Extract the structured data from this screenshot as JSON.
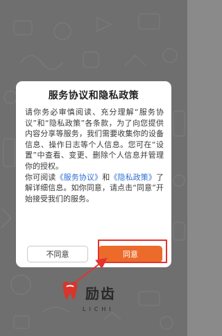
{
  "dialog": {
    "title": "服务协议和隐私政策",
    "paragraph1": "请你务必审慎阅读、充分理解“服务协议”和“隐私政策”各条款，为了向您提供内容分享等服务，我们需要收集你的设备信息、操作日志等个人信息。您可在“设置”中查看、变更、删除个人信息并管理你的授权。",
    "p2_prefix": "你可阅读",
    "service_link": "《服务协议》",
    "p2_and": "和",
    "privacy_link": "《隐私政策》",
    "p2_suffix": "了解详细信息。如你同意，请点击“同意”开始接受我们的服务。",
    "disagree_label": "不同意",
    "agree_label": "同意"
  },
  "logo": {
    "text_cn": "励齿",
    "text_en": "LICHI"
  },
  "colors": {
    "accent": "#ec6a2a",
    "link": "#2f6fd6",
    "annotation": "#e3342f",
    "logo_red": "#d8352b"
  },
  "icons": {
    "logo_mark": "tooth-logo-icon",
    "annotation": "arrow-annotation-icon"
  }
}
